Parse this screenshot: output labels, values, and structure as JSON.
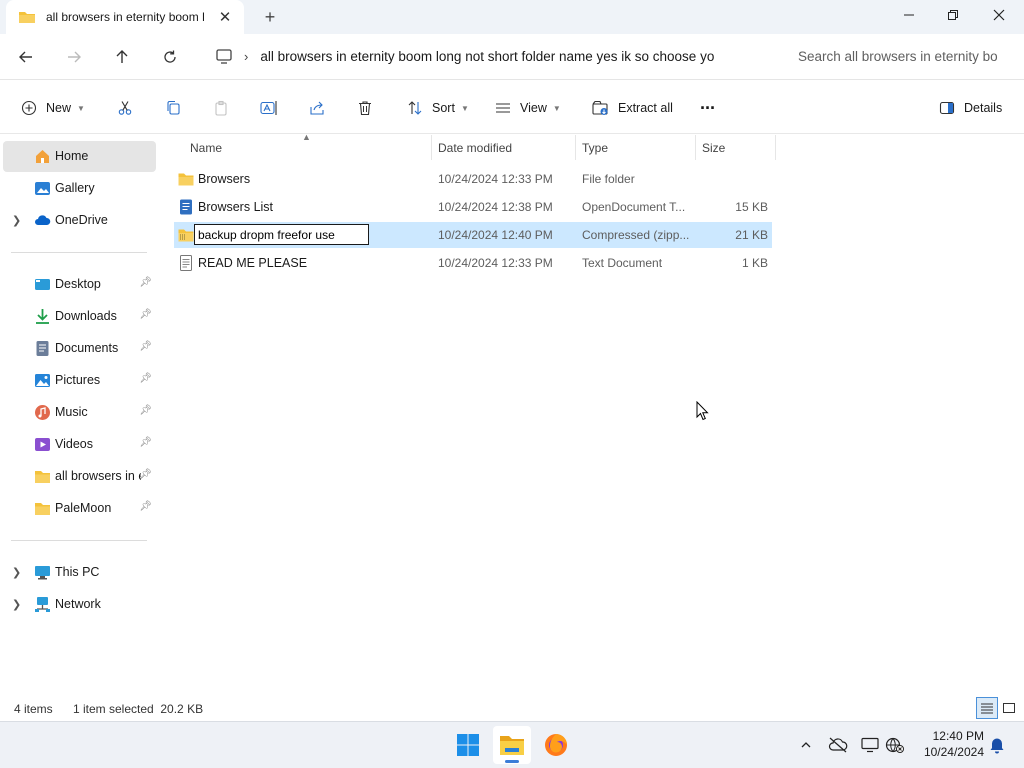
{
  "window": {
    "tab_title": "all browsers in eternity boom l",
    "new_tab": "+",
    "close_tab": "✕"
  },
  "address": {
    "path": "all browsers in eternity boom long not short folder name yes ik so choose yo",
    "search_placeholder": "Search all browsers in eternity bo"
  },
  "toolbar": {
    "new_label": "New",
    "sort_label": "Sort",
    "view_label": "View",
    "extract_label": "Extract all",
    "more_label": "···",
    "details_label": "Details"
  },
  "sidebar": {
    "items": [
      {
        "label": "Home"
      },
      {
        "label": "Gallery"
      },
      {
        "label": "OneDrive"
      },
      {
        "label": "Desktop"
      },
      {
        "label": "Downloads"
      },
      {
        "label": "Documents"
      },
      {
        "label": "Pictures"
      },
      {
        "label": "Music"
      },
      {
        "label": "Videos"
      },
      {
        "label": "all browsers in eternity boom long not short folder name yes ik so choose yo"
      },
      {
        "label": "PaleMoon"
      },
      {
        "label": "This PC"
      },
      {
        "label": "Network"
      }
    ]
  },
  "columns": {
    "name": "Name",
    "date": "Date modified",
    "type": "Type",
    "size": "Size"
  },
  "files": [
    {
      "name": "Browsers",
      "date": "10/24/2024 12:33 PM",
      "type": "File folder",
      "size": ""
    },
    {
      "name": "Browsers List",
      "date": "10/24/2024 12:38 PM",
      "type": "OpenDocument T...",
      "size": "15 KB"
    },
    {
      "name": "backup dropm freefor use",
      "date": "10/24/2024 12:40 PM",
      "type": "Compressed (zipp...",
      "size": "21 KB"
    },
    {
      "name": "READ ME PLEASE",
      "date": "10/24/2024 12:33 PM",
      "type": "Text Document",
      "size": "1 KB"
    }
  ],
  "status": {
    "items": "4 items",
    "selected": "1 item selected  20.2 KB"
  },
  "taskbar": {
    "time": "12:40 PM",
    "date": "10/24/2024"
  },
  "colors": {
    "accent": "#0067c0",
    "selection": "#cce8ff",
    "folder": "#f4c23b"
  }
}
